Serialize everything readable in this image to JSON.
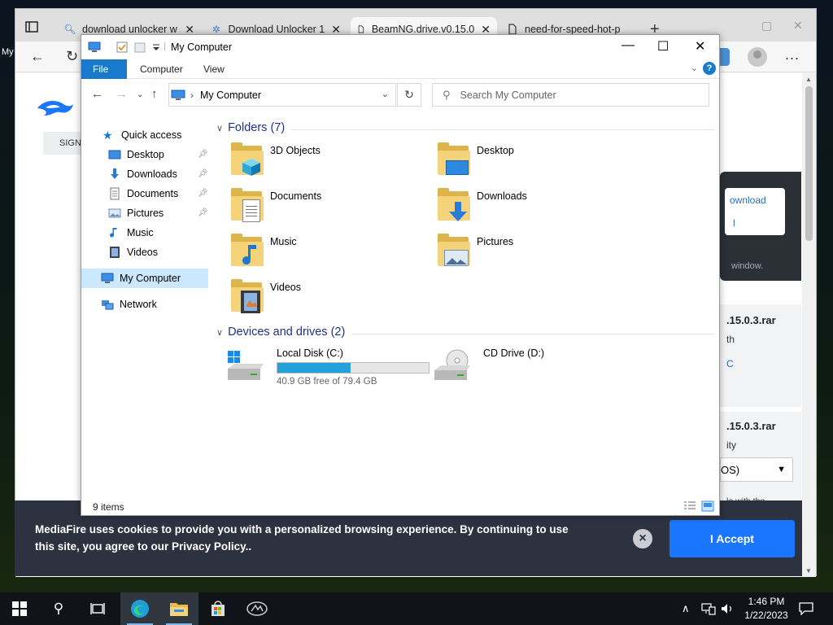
{
  "browser": {
    "tabs": [
      {
        "title": "download unlocker w",
        "icon": "search-icon"
      },
      {
        "title": "Download Unlocker 1",
        "icon": "unlocker-icon"
      },
      {
        "title": "BeamNG.drive.v0.15.0",
        "icon": "page-icon"
      },
      {
        "title": "need-for-speed-hot-p",
        "icon": "page-icon"
      }
    ],
    "new_tab": "+",
    "profile_label": "My",
    "more": "..."
  },
  "webpage": {
    "signin": "SIGN",
    "panel_link1": "ownload",
    "panel_link2": "l",
    "panel_footer": "window.",
    "card1_title": ".15.0.3.rar",
    "card1_sub": "th",
    "card1_link": "C",
    "card2_title": ".15.0.3.rar",
    "card2_sub": "ity",
    "os_select": "OS)",
    "card2_note": "le with the"
  },
  "cookie": {
    "text": "MediaFire uses cookies to provide you with a personalized browsing experience. By continuing to use this site, you agree to our Privacy Policy..",
    "close": "×",
    "accept": "I Accept"
  },
  "explorer": {
    "title": "My Computer",
    "ribbon_tabs": [
      "File",
      "Computer",
      "View"
    ],
    "help": "?",
    "address": "My Computer",
    "search_placeholder": "Search My Computer",
    "nav": {
      "quick_access": "Quick access",
      "items": [
        "Desktop",
        "Downloads",
        "Documents",
        "Pictures",
        "Music",
        "Videos"
      ],
      "my_computer": "My Computer",
      "network": "Network"
    },
    "folders_header": "Folders (7)",
    "folders": [
      "3D Objects",
      "Desktop",
      "Documents",
      "Downloads",
      "Music",
      "Pictures",
      "Videos"
    ],
    "devices_header": "Devices and drives (2)",
    "drives": [
      {
        "name": "Local Disk (C:)",
        "free_text": "40.9 GB free of 79.4 GB",
        "used_fraction": 0.485
      },
      {
        "name": "CD Drive (D:)"
      }
    ],
    "status": "9 items"
  },
  "taskbar": {
    "time": "1:46 PM",
    "date": "1/22/2023"
  },
  "colors": {
    "accent": "#1979ca",
    "drive_fill": "#26a0da",
    "cookie_bg": "#2c3240",
    "accept": "#1a75ff"
  }
}
